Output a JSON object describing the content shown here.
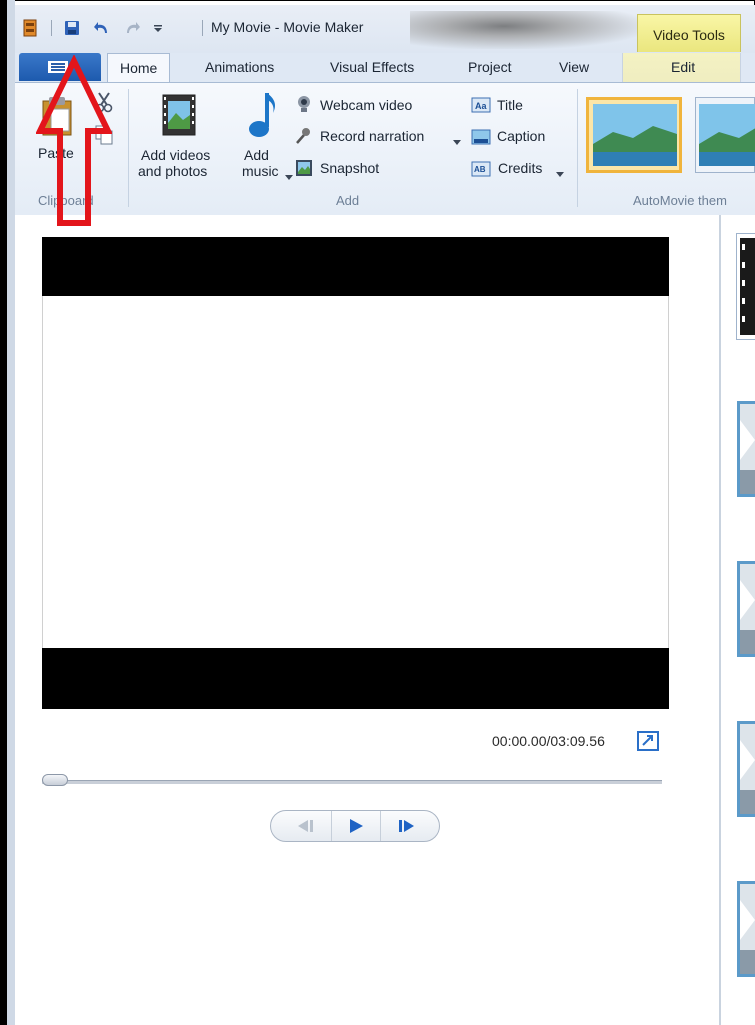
{
  "window": {
    "title": "My Movie - Movie Maker",
    "contextual_tab_group": "Video Tools"
  },
  "tabs": [
    {
      "label": "Home",
      "active": true
    },
    {
      "label": "Animations"
    },
    {
      "label": "Visual Effects"
    },
    {
      "label": "Project"
    },
    {
      "label": "View"
    },
    {
      "label": "Edit"
    }
  ],
  "ribbon": {
    "clipboard": {
      "paste_label": "Paste",
      "group_label": "Clipboard"
    },
    "add": {
      "add_videos_line1": "Add videos",
      "add_videos_line2": "and photos",
      "add_music_line1": "Add",
      "add_music_line2": "music",
      "webcam_label": "Webcam video",
      "narration_label": "Record narration",
      "snapshot_label": "Snapshot",
      "title_label": "Title",
      "caption_label": "Caption",
      "credits_label": "Credits",
      "group_label": "Add"
    },
    "automovie": {
      "group_label": "AutoMovie them"
    }
  },
  "preview": {
    "timecode": "00:00.00/03:09.56",
    "seek_position": 0
  },
  "colors": {
    "annotation": "#e3151b",
    "accent": "#2a6fc8",
    "contextual": "#eae67e"
  }
}
